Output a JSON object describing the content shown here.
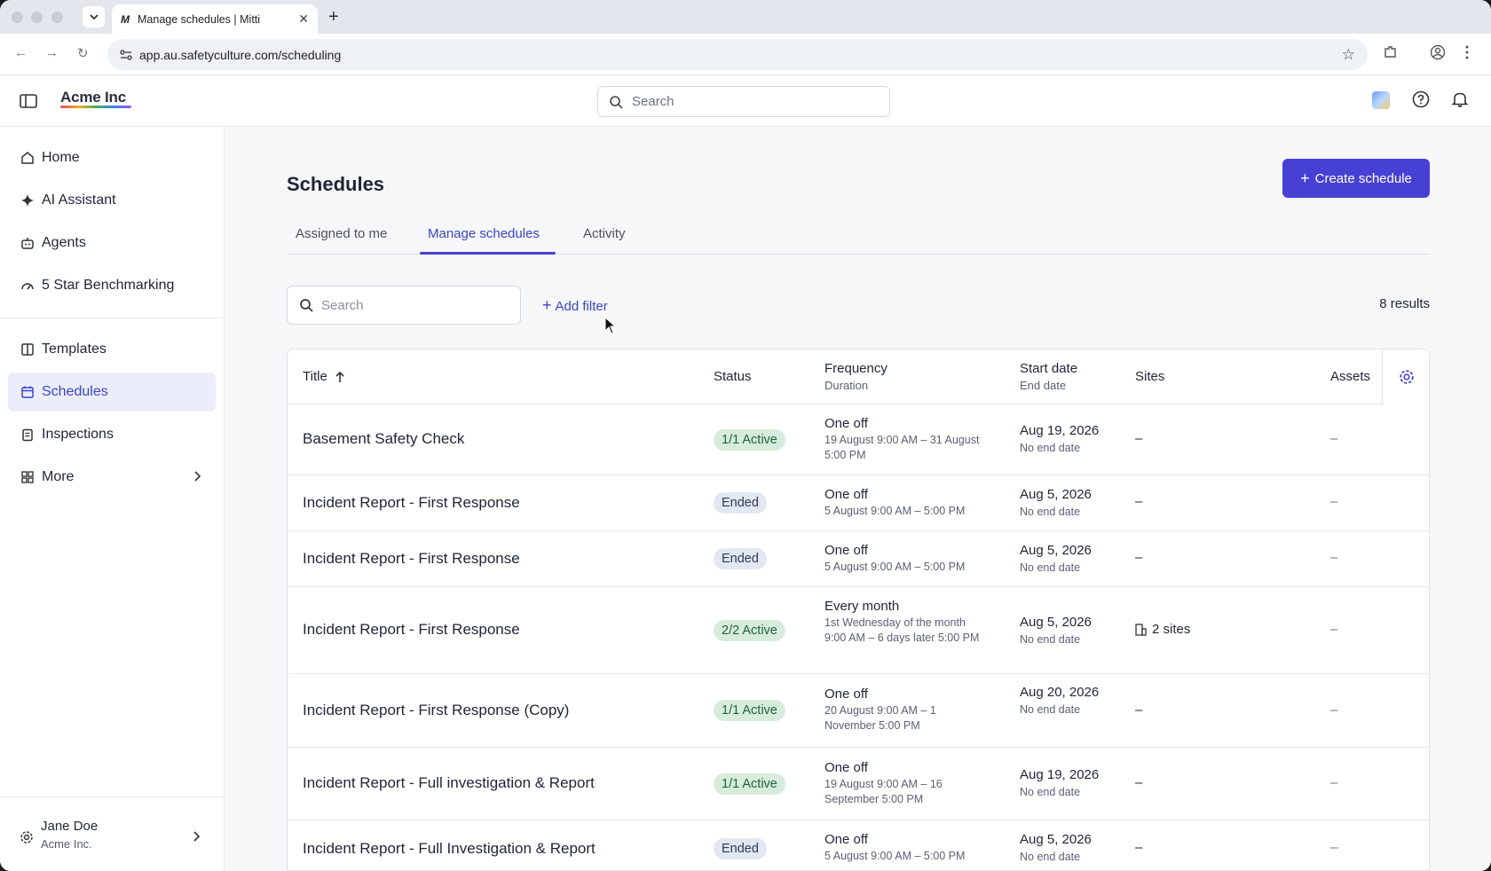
{
  "browser": {
    "tab_title": "Manage schedules | Mitti",
    "tab_favicon": "M",
    "url": "app.au.safetyculture.com/scheduling"
  },
  "header": {
    "brand": "Acme Inc",
    "search_placeholder": "Search"
  },
  "sidebar": {
    "items": [
      {
        "label": "Home",
        "icon": "home-icon"
      },
      {
        "label": "AI Assistant",
        "icon": "sparkle-icon"
      },
      {
        "label": "Agents",
        "icon": "robot-icon"
      },
      {
        "label": "5 Star Benchmarking",
        "icon": "gauge-icon"
      },
      {
        "label": "Templates",
        "icon": "template-icon"
      },
      {
        "label": "Schedules",
        "icon": "calendar-icon",
        "active": true
      },
      {
        "label": "Inspections",
        "icon": "clipboard-icon"
      },
      {
        "label": "More",
        "icon": "grid-icon"
      }
    ],
    "user": {
      "name": "Jane Doe",
      "org": "Acme Inc."
    }
  },
  "main": {
    "title": "Schedules",
    "create_button": "Create schedule",
    "tabs": [
      {
        "label": "Assigned to me"
      },
      {
        "label": "Manage schedules",
        "active": true
      },
      {
        "label": "Activity"
      }
    ],
    "search_placeholder": "Search",
    "add_filter": "Add filter",
    "results": "8 results"
  },
  "table": {
    "headers": {
      "title": "Title",
      "status": "Status",
      "frequency": "Frequency",
      "duration": "Duration",
      "start_date": "Start date",
      "end_date": "End date",
      "sites": "Sites",
      "assets": "Assets"
    },
    "rows": [
      {
        "title": "Basement Safety Check",
        "status": "1/1 Active",
        "status_type": "active",
        "frequency": "One off",
        "duration": "19 August 9:00 AM – 31 August 5:00 PM",
        "start": "Aug 19, 2026",
        "end": "No end date",
        "sites": "–",
        "assets": "–"
      },
      {
        "title": "Incident Report - First Response",
        "status": "Ended",
        "status_type": "ended",
        "frequency": "One off",
        "duration": "5 August 9:00 AM – 5:00 PM",
        "start": "Aug 5, 2026",
        "end": "No end date",
        "sites": "–",
        "assets": "–"
      },
      {
        "title": "Incident Report - First Response",
        "status": "Ended",
        "status_type": "ended",
        "frequency": "One off",
        "duration": "5 August 9:00 AM – 5:00 PM",
        "start": "Aug 5, 2026",
        "end": "No end date",
        "sites": "–",
        "assets": "–"
      },
      {
        "title": "Incident Report - First Response",
        "status": "2/2 Active",
        "status_type": "active",
        "frequency": "Every month",
        "duration": "1st Wednesday of the month 9:00 AM – 6 days later 5:00 PM",
        "start": "Aug 5, 2026",
        "end": "No end date",
        "sites": "2 sites",
        "assets": "–"
      },
      {
        "title": "Incident Report - First Response (Copy)",
        "status": "1/1 Active",
        "status_type": "active",
        "frequency": "One off",
        "duration": "20 August 9:00 AM – 1 November 5:00 PM",
        "start": "Aug 20, 2026",
        "end": "No end date",
        "sites": "–",
        "assets": "–"
      },
      {
        "title": "Incident Report - Full investigation & Report",
        "status": "1/1 Active",
        "status_type": "active",
        "frequency": "One off",
        "duration": "19 August 9:00 AM – 16 September 5:00 PM",
        "start": "Aug 19, 2026",
        "end": "No end date",
        "sites": "–",
        "assets": "–"
      },
      {
        "title": "Incident Report - Full Investigation & Report",
        "status": "Ended",
        "status_type": "ended",
        "frequency": "One off",
        "duration": "5 August 9:00 AM – 5:00 PM",
        "start": "Aug 5, 2026",
        "end": "No end date",
        "sites": "–",
        "assets": "–"
      }
    ]
  },
  "colors": {
    "accent": "#4740d4",
    "active_badge_bg": "#d7ecdc",
    "ended_badge_bg": "#e3e7f1"
  }
}
